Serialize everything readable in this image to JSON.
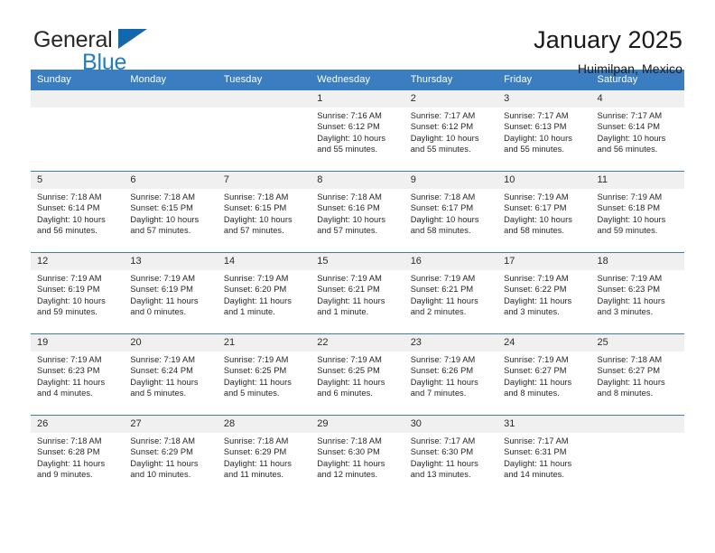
{
  "brand": {
    "name_part1": "General",
    "name_part2": "Blue",
    "logo_icon": "triangle-logo"
  },
  "header": {
    "title": "January 2025",
    "subtitle": "Huimilpan, Mexico"
  },
  "colors": {
    "header_blue": "#3a7dc0",
    "brand_blue": "#1f7ec4",
    "logo_blue": "#1168ae",
    "daynum_bg": "#f0f0f0"
  },
  "weekday_headers": [
    "Sunday",
    "Monday",
    "Tuesday",
    "Wednesday",
    "Thursday",
    "Friday",
    "Saturday"
  ],
  "weeks": [
    [
      {
        "day": "",
        "lines": []
      },
      {
        "day": "",
        "lines": []
      },
      {
        "day": "",
        "lines": []
      },
      {
        "day": "1",
        "lines": [
          "Sunrise: 7:16 AM",
          "Sunset: 6:12 PM",
          "Daylight: 10 hours",
          "and 55 minutes."
        ]
      },
      {
        "day": "2",
        "lines": [
          "Sunrise: 7:17 AM",
          "Sunset: 6:12 PM",
          "Daylight: 10 hours",
          "and 55 minutes."
        ]
      },
      {
        "day": "3",
        "lines": [
          "Sunrise: 7:17 AM",
          "Sunset: 6:13 PM",
          "Daylight: 10 hours",
          "and 55 minutes."
        ]
      },
      {
        "day": "4",
        "lines": [
          "Sunrise: 7:17 AM",
          "Sunset: 6:14 PM",
          "Daylight: 10 hours",
          "and 56 minutes."
        ]
      }
    ],
    [
      {
        "day": "5",
        "lines": [
          "Sunrise: 7:18 AM",
          "Sunset: 6:14 PM",
          "Daylight: 10 hours",
          "and 56 minutes."
        ]
      },
      {
        "day": "6",
        "lines": [
          "Sunrise: 7:18 AM",
          "Sunset: 6:15 PM",
          "Daylight: 10 hours",
          "and 57 minutes."
        ]
      },
      {
        "day": "7",
        "lines": [
          "Sunrise: 7:18 AM",
          "Sunset: 6:15 PM",
          "Daylight: 10 hours",
          "and 57 minutes."
        ]
      },
      {
        "day": "8",
        "lines": [
          "Sunrise: 7:18 AM",
          "Sunset: 6:16 PM",
          "Daylight: 10 hours",
          "and 57 minutes."
        ]
      },
      {
        "day": "9",
        "lines": [
          "Sunrise: 7:18 AM",
          "Sunset: 6:17 PM",
          "Daylight: 10 hours",
          "and 58 minutes."
        ]
      },
      {
        "day": "10",
        "lines": [
          "Sunrise: 7:19 AM",
          "Sunset: 6:17 PM",
          "Daylight: 10 hours",
          "and 58 minutes."
        ]
      },
      {
        "day": "11",
        "lines": [
          "Sunrise: 7:19 AM",
          "Sunset: 6:18 PM",
          "Daylight: 10 hours",
          "and 59 minutes."
        ]
      }
    ],
    [
      {
        "day": "12",
        "lines": [
          "Sunrise: 7:19 AM",
          "Sunset: 6:19 PM",
          "Daylight: 10 hours",
          "and 59 minutes."
        ]
      },
      {
        "day": "13",
        "lines": [
          "Sunrise: 7:19 AM",
          "Sunset: 6:19 PM",
          "Daylight: 11 hours",
          "and 0 minutes."
        ]
      },
      {
        "day": "14",
        "lines": [
          "Sunrise: 7:19 AM",
          "Sunset: 6:20 PM",
          "Daylight: 11 hours",
          "and 1 minute."
        ]
      },
      {
        "day": "15",
        "lines": [
          "Sunrise: 7:19 AM",
          "Sunset: 6:21 PM",
          "Daylight: 11 hours",
          "and 1 minute."
        ]
      },
      {
        "day": "16",
        "lines": [
          "Sunrise: 7:19 AM",
          "Sunset: 6:21 PM",
          "Daylight: 11 hours",
          "and 2 minutes."
        ]
      },
      {
        "day": "17",
        "lines": [
          "Sunrise: 7:19 AM",
          "Sunset: 6:22 PM",
          "Daylight: 11 hours",
          "and 3 minutes."
        ]
      },
      {
        "day": "18",
        "lines": [
          "Sunrise: 7:19 AM",
          "Sunset: 6:23 PM",
          "Daylight: 11 hours",
          "and 3 minutes."
        ]
      }
    ],
    [
      {
        "day": "19",
        "lines": [
          "Sunrise: 7:19 AM",
          "Sunset: 6:23 PM",
          "Daylight: 11 hours",
          "and 4 minutes."
        ]
      },
      {
        "day": "20",
        "lines": [
          "Sunrise: 7:19 AM",
          "Sunset: 6:24 PM",
          "Daylight: 11 hours",
          "and 5 minutes."
        ]
      },
      {
        "day": "21",
        "lines": [
          "Sunrise: 7:19 AM",
          "Sunset: 6:25 PM",
          "Daylight: 11 hours",
          "and 5 minutes."
        ]
      },
      {
        "day": "22",
        "lines": [
          "Sunrise: 7:19 AM",
          "Sunset: 6:25 PM",
          "Daylight: 11 hours",
          "and 6 minutes."
        ]
      },
      {
        "day": "23",
        "lines": [
          "Sunrise: 7:19 AM",
          "Sunset: 6:26 PM",
          "Daylight: 11 hours",
          "and 7 minutes."
        ]
      },
      {
        "day": "24",
        "lines": [
          "Sunrise: 7:19 AM",
          "Sunset: 6:27 PM",
          "Daylight: 11 hours",
          "and 8 minutes."
        ]
      },
      {
        "day": "25",
        "lines": [
          "Sunrise: 7:18 AM",
          "Sunset: 6:27 PM",
          "Daylight: 11 hours",
          "and 8 minutes."
        ]
      }
    ],
    [
      {
        "day": "26",
        "lines": [
          "Sunrise: 7:18 AM",
          "Sunset: 6:28 PM",
          "Daylight: 11 hours",
          "and 9 minutes."
        ]
      },
      {
        "day": "27",
        "lines": [
          "Sunrise: 7:18 AM",
          "Sunset: 6:29 PM",
          "Daylight: 11 hours",
          "and 10 minutes."
        ]
      },
      {
        "day": "28",
        "lines": [
          "Sunrise: 7:18 AM",
          "Sunset: 6:29 PM",
          "Daylight: 11 hours",
          "and 11 minutes."
        ]
      },
      {
        "day": "29",
        "lines": [
          "Sunrise: 7:18 AM",
          "Sunset: 6:30 PM",
          "Daylight: 11 hours",
          "and 12 minutes."
        ]
      },
      {
        "day": "30",
        "lines": [
          "Sunrise: 7:17 AM",
          "Sunset: 6:30 PM",
          "Daylight: 11 hours",
          "and 13 minutes."
        ]
      },
      {
        "day": "31",
        "lines": [
          "Sunrise: 7:17 AM",
          "Sunset: 6:31 PM",
          "Daylight: 11 hours",
          "and 14 minutes."
        ]
      },
      {
        "day": "",
        "lines": []
      }
    ]
  ]
}
